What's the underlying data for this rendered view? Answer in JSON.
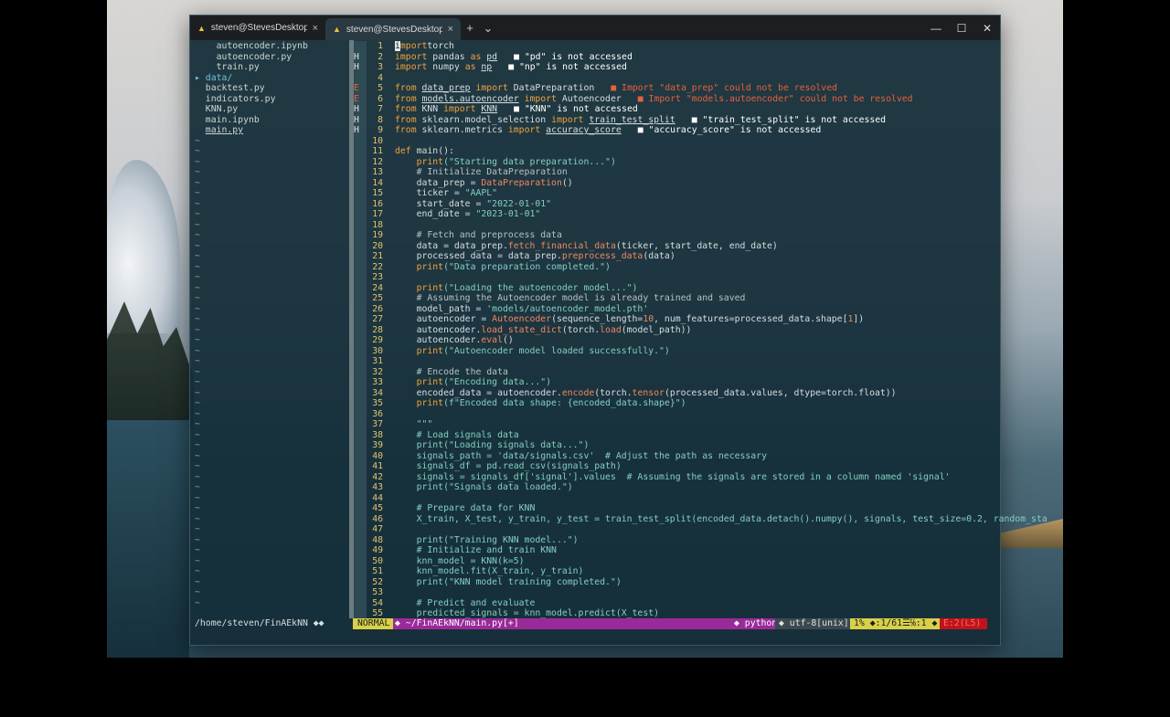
{
  "tabs": [
    {
      "label": "steven@StevesDesktop: ~/Fin",
      "active": false
    },
    {
      "label": "steven@StevesDesktop: ~/Fin",
      "active": true
    }
  ],
  "titlebar": {
    "new_tab": "+",
    "dropdown": "⌄",
    "minimize": "—",
    "maximize": "☐",
    "close": "✕"
  },
  "tree": {
    "files": [
      {
        "text": "  autoencoder.ipynb",
        "kind": "file"
      },
      {
        "text": "  autoencoder.py",
        "kind": "file"
      },
      {
        "text": "  train.py",
        "kind": "file"
      },
      {
        "text": "data/",
        "kind": "dir",
        "arrow": "▸"
      },
      {
        "text": "backtest.py",
        "kind": "file"
      },
      {
        "text": "indicators.py",
        "kind": "file"
      },
      {
        "text": "KNN.py",
        "kind": "file"
      },
      {
        "text": "main.ipynb",
        "kind": "file"
      },
      {
        "text": "main.py",
        "kind": "current"
      }
    ],
    "tilde": "~",
    "tilde_count": 45
  },
  "editor": {
    "lines": [
      {
        "n": "1",
        "sign": "",
        "segs": [
          [
            "cursor",
            "i"
          ],
          [
            "kw",
            "mport"
          ],
          [
            "",
            "torch"
          ]
        ]
      },
      {
        "n": "2",
        "sign": "H",
        "segs": [
          [
            "kw",
            "import"
          ],
          [
            "",
            " pandas "
          ],
          [
            "kw",
            "as"
          ],
          [
            "",
            " "
          ],
          [
            "ul",
            "pd"
          ]
        ],
        "diag": "■ \"pd\" is not accessed",
        "dk": "H"
      },
      {
        "n": "3",
        "sign": "H",
        "segs": [
          [
            "kw",
            "import"
          ],
          [
            "",
            " numpy "
          ],
          [
            "kw",
            "as"
          ],
          [
            "",
            " "
          ],
          [
            "ul",
            "np"
          ]
        ],
        "diag": "■ \"np\" is not accessed",
        "dk": "H"
      },
      {
        "n": "4",
        "sign": "",
        "segs": []
      },
      {
        "n": "5",
        "sign": "E",
        "segs": [
          [
            "kw",
            "from"
          ],
          [
            "",
            " "
          ],
          [
            "ul",
            "data_prep"
          ],
          [
            "",
            " "
          ],
          [
            "kw",
            "import"
          ],
          [
            "",
            " DataPreparation"
          ]
        ],
        "diag": "■ Import \"data_prep\" could not be resolved",
        "dk": "E"
      },
      {
        "n": "6",
        "sign": "E",
        "segs": [
          [
            "kw",
            "from"
          ],
          [
            "",
            " "
          ],
          [
            "ul",
            "models.autoencoder"
          ],
          [
            "",
            " "
          ],
          [
            "kw",
            "import"
          ],
          [
            "",
            " Autoencoder"
          ]
        ],
        "diag": "■ Import \"models.autoencoder\" could not be resolved",
        "dk": "E"
      },
      {
        "n": "7",
        "sign": "H",
        "segs": [
          [
            "kw",
            "from"
          ],
          [
            "",
            " KNN "
          ],
          [
            "kw",
            "import"
          ],
          [
            "",
            " "
          ],
          [
            "ul",
            "KNN"
          ]
        ],
        "diag": "■ \"KNN\" is not accessed",
        "dk": "H"
      },
      {
        "n": "8",
        "sign": "H",
        "segs": [
          [
            "kw",
            "from"
          ],
          [
            "",
            " sklearn.model_selection "
          ],
          [
            "kw",
            "import"
          ],
          [
            "",
            " "
          ],
          [
            "ul",
            "train_test_split"
          ]
        ],
        "diag": "■ \"train_test_split\" is not accessed",
        "dk": "H"
      },
      {
        "n": "9",
        "sign": "H",
        "segs": [
          [
            "kw",
            "from"
          ],
          [
            "",
            " sklearn.metrics "
          ],
          [
            "kw",
            "import"
          ],
          [
            "",
            " "
          ],
          [
            "ul",
            "accuracy_score"
          ]
        ],
        "diag": "■ \"accuracy_score\" is not accessed",
        "dk": "H"
      },
      {
        "n": "10",
        "sign": "",
        "segs": []
      },
      {
        "n": "11",
        "sign": "",
        "segs": [
          [
            "kw",
            "def"
          ],
          [
            "",
            " main():"
          ]
        ]
      },
      {
        "n": "12",
        "sign": "",
        "segs": [
          [
            "",
            "    "
          ],
          [
            "kw",
            "print"
          ],
          [
            "str",
            "(\"Starting data preparation...\")"
          ]
        ]
      },
      {
        "n": "13",
        "sign": "",
        "segs": [
          [
            "cm",
            "    # Initialize DataPreparation"
          ]
        ]
      },
      {
        "n": "14",
        "sign": "",
        "segs": [
          [
            "",
            "    data_prep = "
          ],
          [
            "fn",
            "DataPreparation"
          ],
          [
            "",
            "()"
          ]
        ]
      },
      {
        "n": "15",
        "sign": "",
        "segs": [
          [
            "",
            "    ticker = "
          ],
          [
            "str",
            "\"AAPL\""
          ]
        ]
      },
      {
        "n": "16",
        "sign": "",
        "segs": [
          [
            "",
            "    start_date = "
          ],
          [
            "str",
            "\"2022-01-01\""
          ]
        ]
      },
      {
        "n": "17",
        "sign": "",
        "segs": [
          [
            "",
            "    end_date = "
          ],
          [
            "str",
            "\"2023-01-01\""
          ]
        ]
      },
      {
        "n": "18",
        "sign": "",
        "segs": []
      },
      {
        "n": "19",
        "sign": "",
        "segs": [
          [
            "cm",
            "    # Fetch and preprocess data"
          ]
        ]
      },
      {
        "n": "20",
        "sign": "",
        "segs": [
          [
            "",
            "    data = data_prep."
          ],
          [
            "fn",
            "fetch_financial_data"
          ],
          [
            "",
            "(ticker, start_date, end_date)"
          ]
        ]
      },
      {
        "n": "21",
        "sign": "",
        "segs": [
          [
            "",
            "    processed_data = data_prep."
          ],
          [
            "fn",
            "preprocess_data"
          ],
          [
            "",
            "(data)"
          ]
        ]
      },
      {
        "n": "22",
        "sign": "",
        "segs": [
          [
            "",
            "    "
          ],
          [
            "kw",
            "print"
          ],
          [
            "str",
            "(\"Data preparation completed.\")"
          ]
        ]
      },
      {
        "n": "23",
        "sign": "",
        "segs": []
      },
      {
        "n": "24",
        "sign": "",
        "segs": [
          [
            "",
            "    "
          ],
          [
            "kw",
            "print"
          ],
          [
            "str",
            "(\"Loading the autoencoder model...\")"
          ]
        ]
      },
      {
        "n": "25",
        "sign": "",
        "segs": [
          [
            "cm",
            "    # Assuming the Autoencoder model is already trained and saved"
          ]
        ]
      },
      {
        "n": "26",
        "sign": "",
        "segs": [
          [
            "",
            "    model_path = "
          ],
          [
            "str",
            "'models/autoencoder_model.pth'"
          ]
        ]
      },
      {
        "n": "27",
        "sign": "",
        "segs": [
          [
            "",
            "    autoencoder = "
          ],
          [
            "fn",
            "Autoencoder"
          ],
          [
            "",
            "(sequence_length="
          ],
          [
            "num",
            "10"
          ],
          [
            "",
            ", num_features=processed_data.shape["
          ],
          [
            "num",
            "1"
          ],
          [
            "",
            "])"
          ]
        ]
      },
      {
        "n": "28",
        "sign": "",
        "segs": [
          [
            "",
            "    autoencoder."
          ],
          [
            "fn",
            "load_state_dict"
          ],
          [
            "",
            "(torch."
          ],
          [
            "fn",
            "load"
          ],
          [
            "",
            "(model_path))"
          ]
        ]
      },
      {
        "n": "29",
        "sign": "",
        "segs": [
          [
            "",
            "    autoencoder."
          ],
          [
            "fn",
            "eval"
          ],
          [
            "",
            "()"
          ]
        ]
      },
      {
        "n": "30",
        "sign": "",
        "segs": [
          [
            "",
            "    "
          ],
          [
            "kw",
            "print"
          ],
          [
            "str",
            "(\"Autoencoder model loaded successfully.\")"
          ]
        ]
      },
      {
        "n": "31",
        "sign": "",
        "segs": []
      },
      {
        "n": "32",
        "sign": "",
        "segs": [
          [
            "cm",
            "    # Encode the data"
          ]
        ]
      },
      {
        "n": "33",
        "sign": "",
        "segs": [
          [
            "",
            "    "
          ],
          [
            "kw",
            "print"
          ],
          [
            "str",
            "(\"Encoding data...\")"
          ]
        ]
      },
      {
        "n": "34",
        "sign": "",
        "segs": [
          [
            "",
            "    encoded_data = autoencoder."
          ],
          [
            "fn",
            "encode"
          ],
          [
            "",
            "(torch."
          ],
          [
            "fn",
            "tensor"
          ],
          [
            "",
            "(processed_data.values, dtype=torch.float))"
          ]
        ]
      },
      {
        "n": "35",
        "sign": "",
        "segs": [
          [
            "",
            "    "
          ],
          [
            "kw",
            "print"
          ],
          [
            "str",
            "(f\"Encoded data shape: {encoded_data.shape}\")"
          ]
        ]
      },
      {
        "n": "36",
        "sign": "",
        "segs": []
      },
      {
        "n": "37",
        "sign": "",
        "segs": [
          [
            "str",
            "    \"\"\""
          ]
        ]
      },
      {
        "n": "38",
        "sign": "",
        "segs": [
          [
            "str",
            "    # Load signals data"
          ]
        ]
      },
      {
        "n": "39",
        "sign": "",
        "segs": [
          [
            "str",
            "    print(\"Loading signals data...\")"
          ]
        ]
      },
      {
        "n": "40",
        "sign": "",
        "segs": [
          [
            "str",
            "    signals_path = 'data/signals.csv'  # Adjust the path as necessary"
          ]
        ]
      },
      {
        "n": "41",
        "sign": "",
        "segs": [
          [
            "str",
            "    signals_df = pd.read_csv(signals_path)"
          ]
        ]
      },
      {
        "n": "42",
        "sign": "",
        "segs": [
          [
            "str",
            "    signals = signals_df['signal'].values  # Assuming the signals are stored in a column named 'signal'"
          ]
        ]
      },
      {
        "n": "43",
        "sign": "",
        "segs": [
          [
            "str",
            "    print(\"Signals data loaded.\")"
          ]
        ]
      },
      {
        "n": "44",
        "sign": "",
        "segs": []
      },
      {
        "n": "45",
        "sign": "",
        "segs": [
          [
            "str",
            "    # Prepare data for KNN"
          ]
        ]
      },
      {
        "n": "46",
        "sign": "",
        "segs": [
          [
            "str",
            "    X_train, X_test, y_train, y_test = train_test_split(encoded_data.detach().numpy(), signals, test_size=0.2, random_sta"
          ]
        ]
      },
      {
        "n": "47",
        "sign": "",
        "segs": []
      },
      {
        "n": "48",
        "sign": "",
        "segs": [
          [
            "str",
            "    print(\"Training KNN model...\")"
          ]
        ]
      },
      {
        "n": "49",
        "sign": "",
        "segs": [
          [
            "str",
            "    # Initialize and train KNN"
          ]
        ]
      },
      {
        "n": "50",
        "sign": "",
        "segs": [
          [
            "str",
            "    knn_model = KNN(k=5)"
          ]
        ]
      },
      {
        "n": "51",
        "sign": "",
        "segs": [
          [
            "str",
            "    knn_model.fit(X_train, y_train)"
          ]
        ]
      },
      {
        "n": "52",
        "sign": "",
        "segs": [
          [
            "str",
            "    print(\"KNN model training completed.\")"
          ]
        ]
      },
      {
        "n": "53",
        "sign": "",
        "segs": []
      },
      {
        "n": "54",
        "sign": "",
        "segs": [
          [
            "str",
            "    # Predict and evaluate"
          ]
        ]
      },
      {
        "n": "55",
        "sign": "",
        "segs": [
          [
            "str",
            "    predicted_signals = knn_model.predict(X_test)"
          ]
        ]
      }
    ]
  },
  "statusbar": {
    "tree_path": "/home/steven/FinAEkNN ◆◆",
    "mode": "NORMAL",
    "file": "◆ ~/FinAEkNN/main.py[+]",
    "filetype": "◆ python",
    "encoding": "◆ utf-8[unix] ◆",
    "position": "1% ◆:1/61☰℅:1 ◆",
    "errors": "E:2(L5)"
  },
  "colors": {
    "keyword": "#f0a240",
    "function": "#f08860",
    "string": "#82d0c0",
    "line_number": "#e2c36e",
    "error": "#e8603c",
    "mode_bg": "#d8d048",
    "file_bg": "#9a2a9a"
  }
}
